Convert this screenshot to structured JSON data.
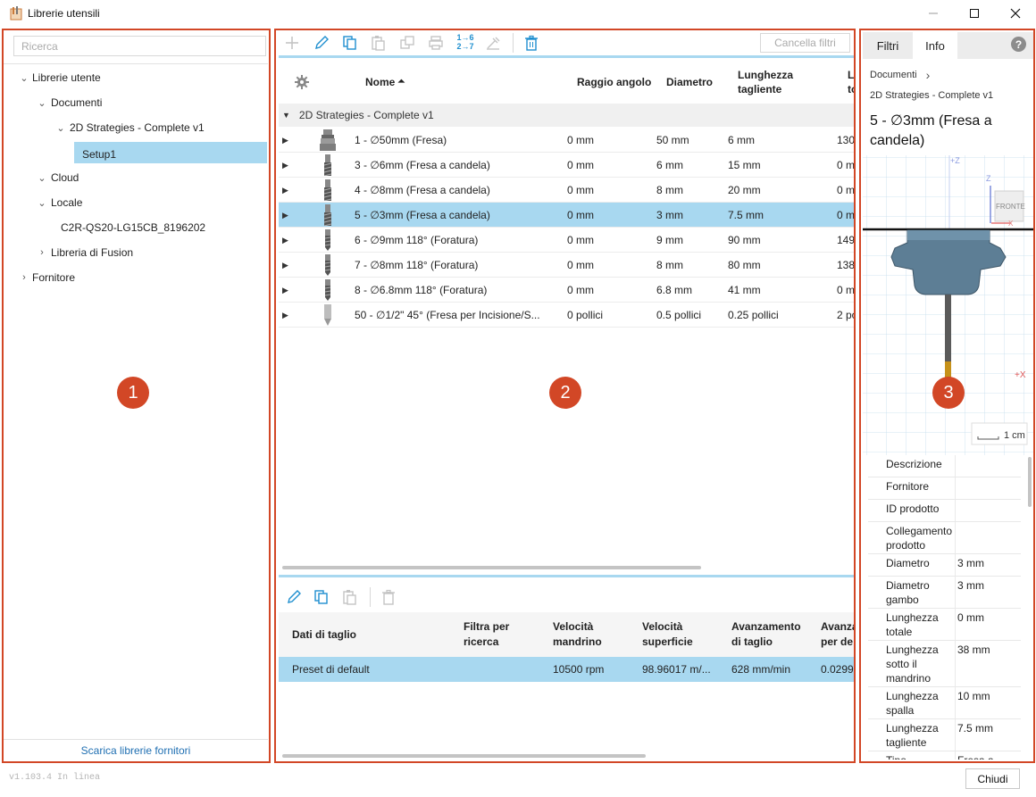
{
  "window": {
    "title": "Librerie utensili",
    "minimize_icon": "minimize-icon",
    "maximize_icon": "maximize-icon",
    "close_icon": "close-icon"
  },
  "left_panel": {
    "badge": "1",
    "search_placeholder": "Ricerca",
    "tree": [
      {
        "label": "Librerie utente",
        "state": "expanded"
      },
      {
        "label": "Documenti",
        "state": "expanded"
      },
      {
        "label": "2D Strategies - Complete v1",
        "state": "expanded"
      },
      {
        "label": "Setup1",
        "state": "selected"
      },
      {
        "label": "Cloud",
        "state": "expanded"
      },
      {
        "label": "Locale",
        "state": "expanded"
      },
      {
        "label": "C2R-QS20-LG15CB_8196202",
        "state": "leaf"
      },
      {
        "label": "Libreria di Fusion",
        "state": "collapsed"
      },
      {
        "label": "Fornitore",
        "state": "collapsed"
      }
    ],
    "footer_link": "Scarica librerie fornitori"
  },
  "center_panel": {
    "badge": "2",
    "toolbar": {
      "icons": [
        "add-icon",
        "edit-icon",
        "copy-icon",
        "paste-icon",
        "duplicate-icon",
        "print-icon",
        "renumber-icon",
        "sharpen-icon",
        "delete-icon"
      ],
      "renumber_text_top": "1→6",
      "renumber_text_bottom": "2→7",
      "clear_filters": "Cancella filtri"
    },
    "table": {
      "headers": {
        "settings_icon": "gear-icon",
        "name": "Nome",
        "sort_indicator": "⏶",
        "corner_radius": "Raggio angolo",
        "diameter": "Diametro",
        "flute_length_line1": "Lunghezza",
        "flute_length_line2": "tagliente",
        "truncated_line1": "L",
        "truncated_line2": "to"
      },
      "group_label": "2D Strategies - Complete v1",
      "rows": [
        {
          "name": "1 - ∅50mm (Fresa)",
          "corner_radius": "0 mm",
          "diameter": "50 mm",
          "flute_length": "6 mm",
          "overall": "130",
          "icon": "face-mill-icon"
        },
        {
          "name": "3 - ∅6mm (Fresa a candela)",
          "corner_radius": "0 mm",
          "diameter": "6 mm",
          "flute_length": "15 mm",
          "overall": "0 m",
          "icon": "end-mill-icon"
        },
        {
          "name": "4 - ∅8mm (Fresa a candela)",
          "corner_radius": "0 mm",
          "diameter": "8 mm",
          "flute_length": "20 mm",
          "overall": "0 m",
          "icon": "end-mill-icon"
        },
        {
          "name": "5 - ∅3mm (Fresa a candela)",
          "corner_radius": "0 mm",
          "diameter": "3 mm",
          "flute_length": "7.5 mm",
          "overall": "0 m",
          "icon": "end-mill-icon",
          "selected": true
        },
        {
          "name": "6 - ∅9mm 118° (Foratura)",
          "corner_radius": "0 mm",
          "diameter": "9 mm",
          "flute_length": "90 mm",
          "overall": "149",
          "icon": "drill-icon"
        },
        {
          "name": "7 - ∅8mm 118° (Foratura)",
          "corner_radius": "0 mm",
          "diameter": "8 mm",
          "flute_length": "80 mm",
          "overall": "138",
          "icon": "drill-icon"
        },
        {
          "name": "8 - ∅6.8mm 118° (Foratura)",
          "corner_radius": "0 mm",
          "diameter": "6.8 mm",
          "flute_length": "41 mm",
          "overall": "0 m",
          "icon": "drill-icon"
        },
        {
          "name": "50 - ∅1/2\" 45° (Fresa per Incisione/S...",
          "corner_radius": "0 pollici",
          "diameter": "0.5 pollici",
          "flute_length": "0.25 pollici",
          "overall": "2 po",
          "icon": "engrave-icon"
        }
      ]
    },
    "cutting_toolbar_icons": [
      "edit-icon",
      "copy-icon",
      "paste-icon",
      "delete-icon"
    ],
    "cutting_table": {
      "headers": {
        "cutting_data": "Dati di taglio",
        "filter_line1": "Filtra per",
        "filter_line2": "ricerca",
        "spindle_line1": "Velocità",
        "spindle_line2": "mandrino",
        "surface_line1": "Velocità",
        "surface_line2": "superficie",
        "feed_line1": "Avanzamento",
        "feed_line2": "di taglio",
        "perdepth_line1": "Avanza",
        "perdepth_line2": "per de"
      },
      "preset": {
        "name": "Preset di default",
        "spindle": "10500 rpm",
        "surface": "98.96017 m/...",
        "feed": "628 mm/min",
        "perdepth": "0.0299"
      }
    }
  },
  "right_panel": {
    "badge": "3",
    "tabs": [
      "Filtri",
      "Info"
    ],
    "active_tab": "Info",
    "help_icon": "?",
    "breadcrumb": "Documenti",
    "breadcrumb_chevron": "›",
    "library_name": "2D Strategies - Complete v1",
    "tool_title": "5 - ∅3mm (Fresa a candela)",
    "preview": {
      "axis_z_top": "+Z",
      "axis_z": "Z",
      "cube_label": "FRONTE",
      "axis_x_small": "X",
      "axis_x": "+X",
      "scale_label": "1 cm"
    },
    "properties": [
      {
        "key": "Descrizione",
        "value": ""
      },
      {
        "key": "Fornitore",
        "value": ""
      },
      {
        "key": "ID prodotto",
        "value": ""
      },
      {
        "key": "Collegamento prodotto",
        "value": ""
      },
      {
        "key": "Diametro",
        "value": "3 mm"
      },
      {
        "key": "Diametro gambo",
        "value": "3 mm"
      },
      {
        "key": "Lunghezza totale",
        "value": "0 mm"
      },
      {
        "key": "Lunghezza sotto il mandrino",
        "value": "38 mm"
      },
      {
        "key": "Lunghezza spalla",
        "value": "10 mm"
      },
      {
        "key": "Lunghezza tagliente",
        "value": "7.5 mm"
      },
      {
        "key": "Tipo",
        "value": "Fresa a candela"
      }
    ]
  },
  "footer": {
    "version": "v1.103.4 In linea",
    "close_button": "Chiudi"
  },
  "colors": {
    "accent_outline": "#d24726",
    "selection": "#a8d8f0",
    "link": "#1f6fb2",
    "toolbar_icon": "#1f8fcf"
  }
}
